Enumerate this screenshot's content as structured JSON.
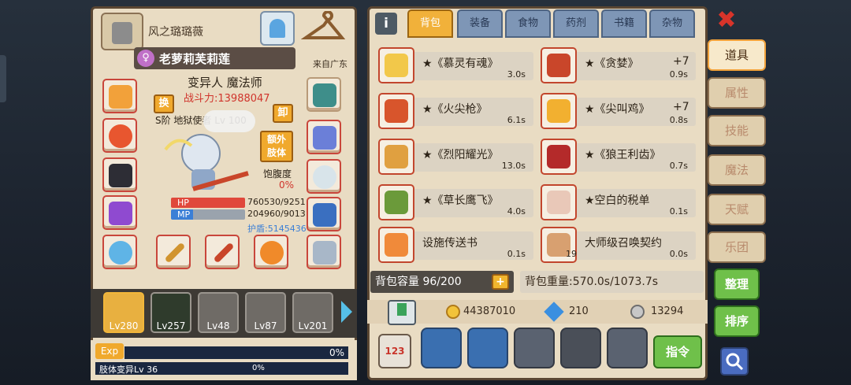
{
  "character": {
    "guild": "风之璐璐薇",
    "name": "老萝莉芙莉莲",
    "origin": "来自广东",
    "class_line": "变异人 魔法师",
    "power": "战斗力:13988047",
    "swap_label": "换",
    "unequip_label": "卸",
    "extra_label_1": "额外",
    "extra_label_2": "肢体",
    "title": "S阶 地狱使者 Lv 100",
    "satiety_label": "饱腹度",
    "satiety_value": "0%",
    "hp_label": "HP",
    "hp_value": "760530/9251",
    "mp_label": "MP",
    "mp_value": "204960/9013",
    "shield": "护盾:5145436"
  },
  "heroes": [
    {
      "level": "Lv280"
    },
    {
      "level": "Lv257"
    },
    {
      "level": "Lv48"
    },
    {
      "level": "Lv87"
    },
    {
      "level": "Lv201"
    }
  ],
  "exp": {
    "label": "Exp",
    "value": "0%",
    "limb_label": "肢体变异Lv 36",
    "limb_value": "0%"
  },
  "tabs": [
    "背包",
    "装备",
    "食物",
    "药剂",
    "书籍",
    "杂物"
  ],
  "items": [
    {
      "name": "★《慕灵有魂》",
      "plus": "",
      "time": "3.0s"
    },
    {
      "name": "★《贪婪》",
      "plus": "+7",
      "time": "0.9s"
    },
    {
      "name": "★《火尖枪》",
      "plus": "",
      "time": "6.1s"
    },
    {
      "name": "★《尖叫鸡》",
      "plus": "+7",
      "time": "0.8s"
    },
    {
      "name": "★《烈阳耀光》",
      "plus": "",
      "time": "13.0s"
    },
    {
      "name": "★《狼王利齿》",
      "plus": "",
      "time": "0.7s"
    },
    {
      "name": "★《草长鹰飞》",
      "plus": "",
      "time": "4.0s"
    },
    {
      "name": "★空白的税单",
      "plus": "",
      "time": "0.1s"
    },
    {
      "name": "设施传送书",
      "plus": "",
      "time": "0.1s"
    },
    {
      "name": "大师级召唤契约",
      "plus": "",
      "time": "0.0s",
      "count": "19"
    }
  ],
  "bag": {
    "capacity": "背包容量 96/200",
    "plus": "+",
    "weight": "背包重量:570.0s/1073.7s"
  },
  "currency": {
    "gold": "44387010",
    "diamond": "210",
    "silver": "13294"
  },
  "action_bar": {
    "sort_icon_text": "123",
    "command_label": "指令"
  },
  "side_tabs": [
    "道具",
    "属性",
    "技能",
    "魔法",
    "天赋",
    "乐团"
  ],
  "buttons": {
    "organize": "整理",
    "sort": "排序"
  },
  "info_icon": "i",
  "close_icon": "✖"
}
